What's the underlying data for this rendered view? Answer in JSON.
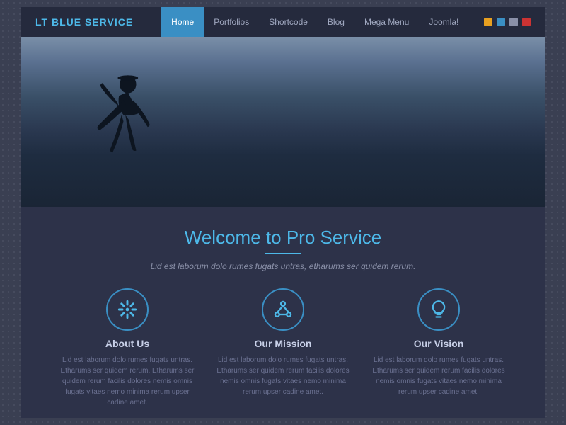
{
  "brand": {
    "name": "LT BLUE SERVICE"
  },
  "navbar": {
    "items": [
      {
        "label": "Home",
        "active": true
      },
      {
        "label": "Portfolios",
        "active": false
      },
      {
        "label": "Shortcode",
        "active": false
      },
      {
        "label": "Blog",
        "active": false
      },
      {
        "label": "Mega Menu",
        "active": false
      },
      {
        "label": "Joomla!",
        "active": false
      }
    ],
    "icons": [
      {
        "color": "#e8a020",
        "label": "icon-orange"
      },
      {
        "color": "#3a8fc4",
        "label": "icon-blue"
      },
      {
        "color": "#8a90a8",
        "label": "icon-gray"
      },
      {
        "color": "#cc3333",
        "label": "icon-red"
      }
    ]
  },
  "welcome": {
    "title_plain": "Welcome to",
    "title_highlight": "Pro Service",
    "subtitle": "Lid est laborum dolo rumes fugats untras, etharums ser quidem rerum."
  },
  "features": [
    {
      "title": "About Us",
      "icon": "asterisk",
      "text": "Lid est laborum dolo rumes fugats untras. Etharums ser quidem rerum. Etharums ser quidem rerum facilis dolores nemis omnis fugats vitaes nemo minima rerum upser cadine amet."
    },
    {
      "title": "Our Mission",
      "icon": "network",
      "text": "Lid est laborum dolo rumes fugats untras. Etharums ser quidem rerum facilis dolores nemis omnis fugats vitaes nemo minima rerum upser cadine amet."
    },
    {
      "title": "Our Vision",
      "icon": "lightbulb",
      "text": "Lid est laborum dolo rumes fugats untras. Etharums ser quidem rerum facilis dolores nemis omnis fugats vitaes nemo minima rerum upser cadine amet."
    }
  ]
}
